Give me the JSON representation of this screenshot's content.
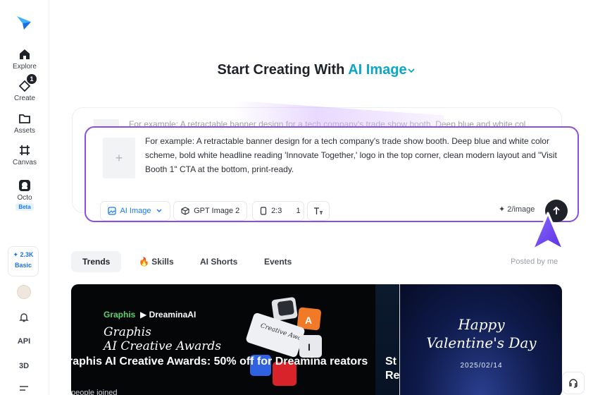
{
  "sidebar": {
    "items": [
      {
        "label": "Explore",
        "icon": "home-icon"
      },
      {
        "label": "Create",
        "icon": "create-icon",
        "badge": "1"
      },
      {
        "label": "Assets",
        "icon": "folder-icon"
      },
      {
        "label": "Canvas",
        "icon": "canvas-icon"
      },
      {
        "label": "Octo",
        "icon": "octo-icon",
        "tag": "Beta"
      }
    ],
    "credits": {
      "amount": "2.3K",
      "tier": "Basic"
    },
    "api_label": "API",
    "threed_label": "3D"
  },
  "header": {
    "title_prefix": "Start Creating With",
    "title_accent": "AI Image"
  },
  "composer": {
    "back_prompt": "For example: A retractable banner design for a tech company's trade show booth. Deep blue and white col",
    "prompt": "For example: A retractable banner design for a tech company's trade show booth. Deep blue and white color scheme, bold white headline reading 'Innovate Together,' logo in the top corner, clean modern layout and \"Visit Booth 1\" CTA at the bottom, print-ready.",
    "mode_label": "AI Image",
    "model_label": "GPT Image 2",
    "ratio_label": "2:3",
    "count_label": "1",
    "cost_label": "2/image"
  },
  "tabs": [
    {
      "label": "Trends",
      "active": true
    },
    {
      "label": "Skills",
      "icon": "fire-icon"
    },
    {
      "label": "AI Shorts"
    },
    {
      "label": "Events"
    }
  ],
  "posted_by": "Posted by me",
  "banners": {
    "b1": {
      "brand_left": "Graphis",
      "brand_right": "DreaminaAI",
      "script_line1": "Graphis",
      "script_line2": "AI Creative Awards",
      "key_text": "Creative Awards",
      "key_a": "A",
      "key_i": "I",
      "title": "raphis AI Creative Awards: 50% off for Dreamina reators",
      "joined": "people joined"
    },
    "b2": {
      "title": "St Re"
    },
    "b3": {
      "line1": "Happy",
      "line2": "Valentine's Day",
      "date": "2025/02/14"
    }
  },
  "colors": {
    "accent": "#0aa7c6",
    "focus": "#8a4fe0",
    "brand_blue": "#1677ff"
  }
}
